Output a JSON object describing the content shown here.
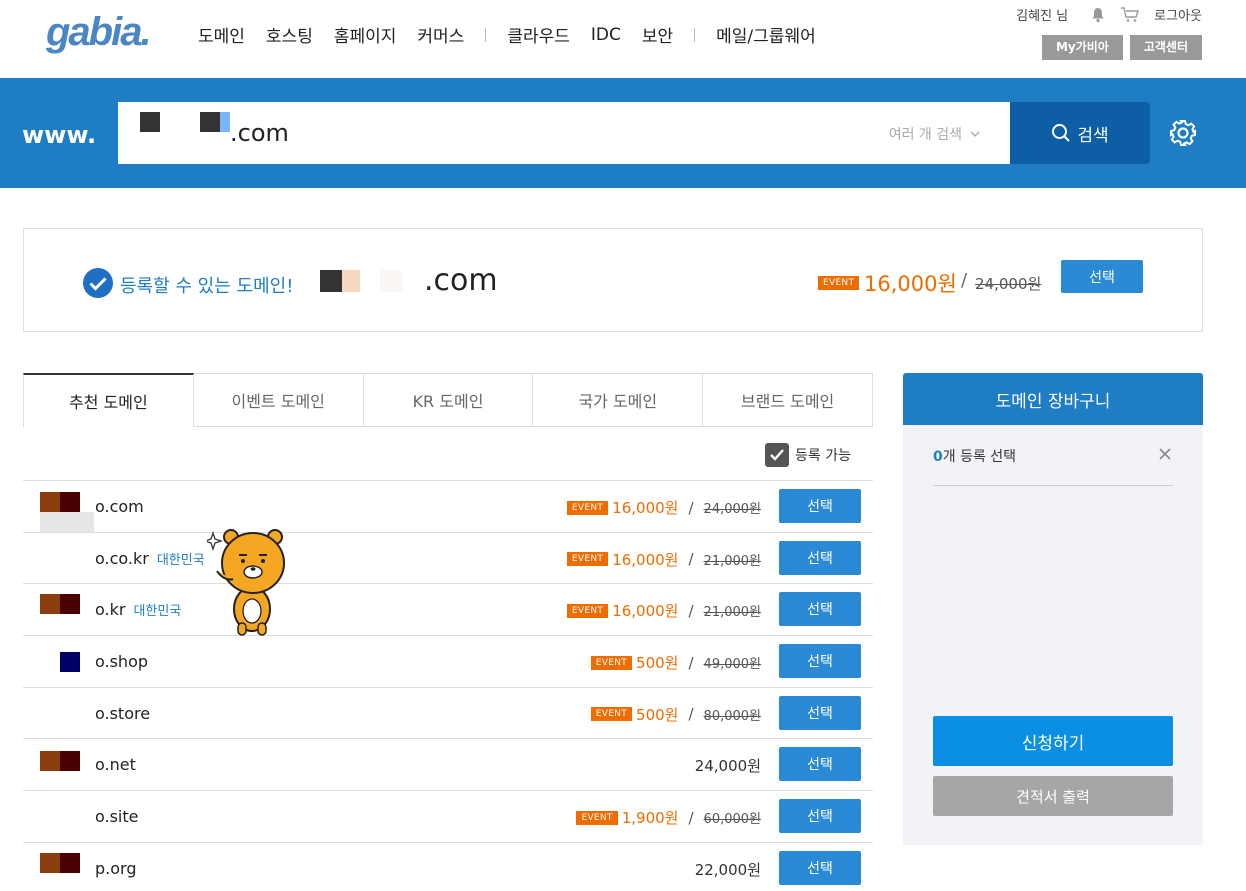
{
  "header": {
    "logo": "gabia.",
    "nav": [
      "도메인",
      "호스팅",
      "홈페이지",
      "커머스",
      "클라우드",
      "IDC",
      "보안",
      "메일/그룹웨어"
    ],
    "user": "김혜진 님",
    "logout": "로그아웃",
    "my_gabia": "My가비아",
    "support": "고객센터"
  },
  "search": {
    "prefix": "www.",
    "value": ".com",
    "multi_search": "여러 개 검색",
    "button": "검색"
  },
  "result": {
    "message": "등록할 수 있는 도메인!",
    "domain": ".com",
    "event": "EVENT",
    "price": "16,000원",
    "old_price": "24,000원",
    "select": "선택"
  },
  "tabs": [
    "추천 도메인",
    "이벤트 도메인",
    "KR 도메인",
    "국가 도메인",
    "브랜드 도메인"
  ],
  "filter": {
    "label": "등록 가능",
    "checked": true
  },
  "domains": [
    {
      "name": "o.com",
      "country": "",
      "event": true,
      "price": "16,000원",
      "old": "24,000원"
    },
    {
      "name": "o.co.kr",
      "country": "대한민국",
      "event": true,
      "price": "16,000원",
      "old": "21,000원"
    },
    {
      "name": "o.kr",
      "country": "대한민국",
      "event": true,
      "price": "16,000원",
      "old": "21,000원"
    },
    {
      "name": "o.shop",
      "country": "",
      "event": true,
      "price": "500원",
      "old": "49,000원"
    },
    {
      "name": "o.store",
      "country": "",
      "event": true,
      "price": "500원",
      "old": "80,000원"
    },
    {
      "name": "o.net",
      "country": "",
      "event": false,
      "price": "24,000원",
      "old": ""
    },
    {
      "name": "o.site",
      "country": "",
      "event": true,
      "price": "1,900원",
      "old": "60,000원"
    },
    {
      "name": "p.org",
      "country": "",
      "event": false,
      "price": "22,000원",
      "old": ""
    }
  ],
  "cart": {
    "title": "도메인 장바구니",
    "count": "0",
    "count_suffix": "개 등록 선택",
    "apply": "신청하기",
    "quote": "견적서 출력"
  },
  "colors": {
    "brand_blue": "#1f7dc4",
    "event_orange": "#ef6c00",
    "select_blue": "#2a8ad6"
  },
  "icons": [
    "bell-icon",
    "cart-icon",
    "search-icon",
    "gear-icon",
    "check-circle-icon",
    "close-icon",
    "chevron-down-icon",
    "ryan-character-icon"
  ]
}
